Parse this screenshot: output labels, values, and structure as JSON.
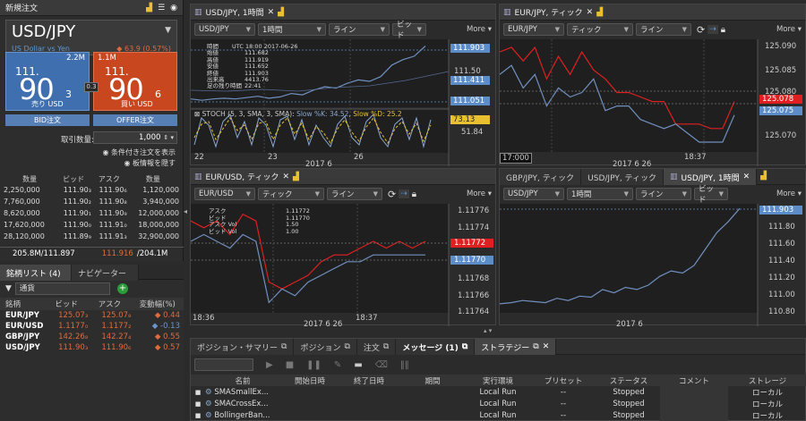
{
  "left": {
    "title": "新規注文",
    "symbol": "USD/JPY",
    "subtitle": "US Dollar vs Yen",
    "change": "◆ 63.9 (0.57%)",
    "sell": {
      "volume": "2.2M",
      "big1": "111.",
      "big2": "90",
      "small": "3",
      "label": "売り USD"
    },
    "buy": {
      "volume": "1.1M",
      "big1": "111.",
      "big2": "90",
      "small": "6",
      "label": "買い USD"
    },
    "spread": "0.3",
    "bid_btn": "BID注文",
    "offer_btn": "OFFER注文",
    "qty_label": "取引数量:",
    "qty_value": "1,000",
    "opt1": "条件付き注文を表示",
    "opt2": "板情報を隠す",
    "depth_headers": [
      "数量",
      "ビッド",
      "アスク",
      "数量"
    ],
    "depth_rows": [
      [
        "2,250,000",
        "111.90₃",
        "111.90₆",
        "1,120,000"
      ],
      [
        "7,760,000",
        "111.90₂",
        "111.90₈",
        "3,940,000"
      ],
      [
        "8,620,000",
        "111.90₁",
        "111.90₉",
        "12,000,000"
      ],
      [
        "17,620,000",
        "111.90₀",
        "111.91₀",
        "18,000,000"
      ],
      [
        "28,120,000",
        "111.89₉",
        "111.91₃",
        "32,900,000"
      ]
    ],
    "depth_footer": {
      "left": "205.8M/111.897",
      "mid": "111.916",
      "right": "/204.1M"
    }
  },
  "watch": {
    "tabs": [
      "銘柄リスト (4)",
      "ナビゲーター"
    ],
    "filter": "通貨",
    "headers": [
      "銘柄",
      "ビッド",
      "アスク",
      "変動幅(%)"
    ],
    "rows": [
      {
        "sym": "EUR/JPY",
        "bid": "125.07₃",
        "ask": "125.07₈",
        "chg": "◆ 0.44",
        "dir": "up"
      },
      {
        "sym": "EUR/USD",
        "bid": "1.1177₀",
        "ask": "1.1177₂",
        "chg": "◆ -0.13",
        "dir": "down"
      },
      {
        "sym": "GBP/JPY",
        "bid": "142.26₈",
        "ask": "142.27₄",
        "chg": "◆ 0.55",
        "dir": "up"
      },
      {
        "sym": "USD/JPY",
        "bid": "111.90₃",
        "ask": "111.90₆",
        "chg": "◆ 0.57",
        "dir": "up"
      }
    ]
  },
  "c1": {
    "tab": "USD/JPY, 1時間",
    "sym": "USD/JPY",
    "period": "1時間",
    "type": "ライン",
    "side": "ビッド",
    "more": "More",
    "info_head": "UTC 18:00 2017-06-26",
    "info": [
      [
        "時間",
        ""
      ],
      [
        "始値",
        "111.682"
      ],
      [
        "高値",
        "111.919"
      ],
      [
        "安値",
        "111.652"
      ],
      [
        "終値",
        "111.903"
      ],
      [
        "出来高",
        "4413.76"
      ],
      [
        "足の残り時間",
        "22:41"
      ]
    ],
    "prices": [
      "111.903",
      "111.50",
      "111.411",
      "111.051"
    ],
    "stoch_label": "STOCH (5, 3, SMA, 3, SMA): ",
    "stoch_k": "Slow %K: 34.52",
    "stoch_d": "Slow %D: 25.2",
    "stoch_axis": [
      "73.13",
      "51.84"
    ],
    "x": [
      "22",
      "23",
      "26"
    ],
    "xlabel": "2017 6"
  },
  "c2": {
    "tab": "EUR/JPY, ティック",
    "sym": "EUR/JPY",
    "period": "ティック",
    "type": "ライン",
    "more": "More",
    "prices": [
      "125.090",
      "125.085",
      "125.080",
      "125.078",
      "125.075",
      "125.070"
    ],
    "x": [
      "17:000",
      "18:37"
    ],
    "xlabel": "2017 6 26"
  },
  "c3": {
    "tab": "EUR/USD, ティック",
    "sym": "EUR/USD",
    "period": "ティック",
    "type": "ライン",
    "more": "More",
    "info": [
      [
        "アスク",
        "1.11772"
      ],
      [
        "ビッド",
        "1.11770"
      ],
      [
        "アスク Vol",
        "1.50"
      ],
      [
        "ビッド Vol",
        "1.00"
      ]
    ],
    "prices": [
      "1.11776",
      "1.11774",
      "1.11772",
      "1.11770",
      "1.11768",
      "1.11766",
      "1.11764"
    ],
    "x": [
      "18:36",
      "18:37"
    ],
    "xlabel": "2017 6 26"
  },
  "c4": {
    "tabs": [
      "GBP/JPY, ティック",
      "USD/JPY, ティック",
      "USD/JPY, 1時間"
    ],
    "sym": "USD/JPY",
    "period": "1時間",
    "type": "ライン",
    "side": "ビッド",
    "more": "More",
    "prices": [
      "111.903",
      "111.80",
      "111.60",
      "111.40",
      "111.20",
      "111.00",
      "110.80"
    ],
    "xlabel": "2017 6"
  },
  "bottom": {
    "tabs": [
      "ポジション・サマリー",
      "ポジション",
      "注文",
      "メッセージ (1)",
      "ストラテジー"
    ],
    "headers": [
      "名前",
      "開始日時",
      "終了日時",
      "期間",
      "実行環境",
      "プリセット",
      "ステータス",
      "コメント",
      "ストレージ"
    ],
    "rows": [
      [
        "SMASmallEx...",
        "",
        "",
        "",
        "Local Run",
        "--",
        "Stopped",
        "",
        "ローカル"
      ],
      [
        "SMACrossEx...",
        "",
        "",
        "",
        "Local Run",
        "--",
        "Stopped",
        "",
        "ローカル"
      ],
      [
        "BollingerBan...",
        "",
        "",
        "",
        "Local Run",
        "--",
        "Stopped",
        "",
        "ローカル"
      ]
    ]
  },
  "colors": {
    "sell": "#3f6fae",
    "buy": "#c8471f",
    "red": "#e02020",
    "blue": "#7090c0",
    "green": "#2a9c3a"
  },
  "chart_data": [
    {
      "type": "line",
      "title": "USD/JPY, 1時間",
      "series": [
        {
          "name": "ビッド",
          "values": [
            111.12,
            111.1,
            111.12,
            111.13,
            111.12,
            111.14,
            111.16,
            111.13,
            111.15,
            111.2,
            111.18,
            111.25,
            111.3,
            111.28,
            111.35,
            111.4,
            111.38,
            111.45,
            111.62,
            111.7,
            111.75,
            111.9
          ]
        }
      ],
      "x_ticks": [
        "22",
        "23",
        "26"
      ]
    },
    {
      "type": "line",
      "title": "EUR/JPY, ティック",
      "series": [
        {
          "name": "red",
          "values": [
            125.089,
            125.09,
            125.087,
            125.09,
            125.083,
            125.088,
            125.084,
            125.089,
            125.085,
            125.083,
            125.08,
            125.08,
            125.079,
            125.078,
            125.078,
            125.073,
            125.073,
            125.073,
            125.072,
            125.072,
            125.078
          ]
        },
        {
          "name": "blue",
          "values": [
            125.084,
            125.086,
            125.081,
            125.084,
            125.077,
            125.081,
            125.079,
            125.08,
            125.083,
            125.076,
            125.077,
            125.077,
            125.074,
            125.073,
            125.072,
            125.073,
            125.071,
            125.069,
            125.069,
            125.069,
            125.075
          ]
        }
      ],
      "x_ticks": [
        "17:000",
        "18:37"
      ]
    },
    {
      "type": "line",
      "title": "EUR/USD, ティック",
      "series": [
        {
          "name": "アスク",
          "values": [
            1.11775,
            1.11774,
            1.11775,
            1.11773,
            1.11776,
            1.11775,
            1.11766,
            1.11765,
            1.11766,
            1.11767,
            1.11769,
            1.1177,
            1.1177,
            1.11771,
            1.11772,
            1.11771,
            1.11772,
            1.11771,
            1.11772
          ]
        },
        {
          "name": "ビッド",
          "values": [
            1.11772,
            1.11773,
            1.11772,
            1.11771,
            1.11773,
            1.11772,
            1.11763,
            1.11765,
            1.11764,
            1.11766,
            1.11767,
            1.11768,
            1.11769,
            1.11769,
            1.1177,
            1.1177,
            1.1177,
            1.1177,
            1.1177
          ]
        }
      ],
      "x_ticks": [
        "18:36",
        "18:37"
      ]
    },
    {
      "type": "line",
      "title": "USD/JPY, 1時間",
      "series": [
        {
          "name": "ビッド",
          "values": [
            111.05,
            111.06,
            111.08,
            111.07,
            111.06,
            111.1,
            111.08,
            111.12,
            111.11,
            111.18,
            111.15,
            111.2,
            111.18,
            111.22,
            111.3,
            111.35,
            111.33,
            111.4,
            111.55,
            111.7,
            111.8,
            111.92
          ]
        }
      ]
    }
  ]
}
